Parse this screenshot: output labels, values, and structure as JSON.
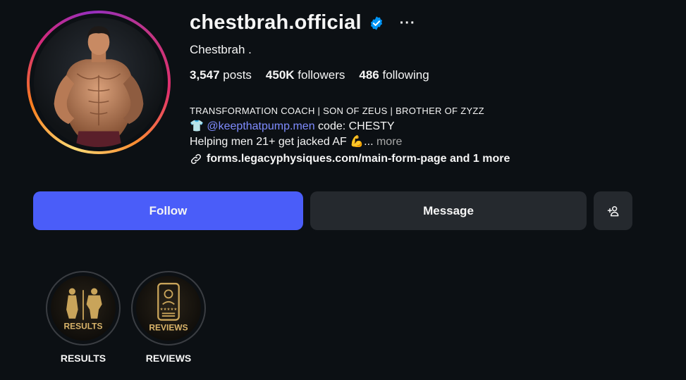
{
  "profile": {
    "username": "chestbrah.official",
    "display_name": "Chestbrah .",
    "stats": {
      "posts_count": "3,547",
      "posts_label": "posts",
      "followers_count": "450K",
      "followers_label": "followers",
      "following_count": "486",
      "following_label": "following"
    },
    "bio": {
      "line1": "TRANSFORMATION COACH | SON OF ZEUS | BROTHER OF ZYZZ",
      "line2_emoji": "👕",
      "line2_handle": "@keepthatpump.men",
      "line2_text": " code: CHESTY",
      "line3_text": "Helping men 21+ get jacked AF ",
      "line3_emoji": "💪",
      "line3_ellipsis": "...",
      "line3_more": " more",
      "link_text": "forms.legacyphysiques.com/main-form-page and 1 more"
    },
    "more_options": "···"
  },
  "actions": {
    "follow_label": "Follow",
    "message_label": "Message"
  },
  "highlights": [
    {
      "title": "RESULTS",
      "art_text": "RESULTS"
    },
    {
      "title": "REVIEWS",
      "art_text": "REVIEWS"
    }
  ],
  "colors": {
    "background": "#0c1014",
    "follow_button": "#4a5df9",
    "secondary_button": "#25292e",
    "handle_link": "#7f8cff",
    "verified_badge": "#0095f6",
    "highlight_gold": "#c9a45a"
  },
  "icons": {
    "verified": "verified-badge-icon",
    "more": "more-horizontal-icon",
    "link": "link-icon",
    "add_user": "add-user-icon"
  }
}
